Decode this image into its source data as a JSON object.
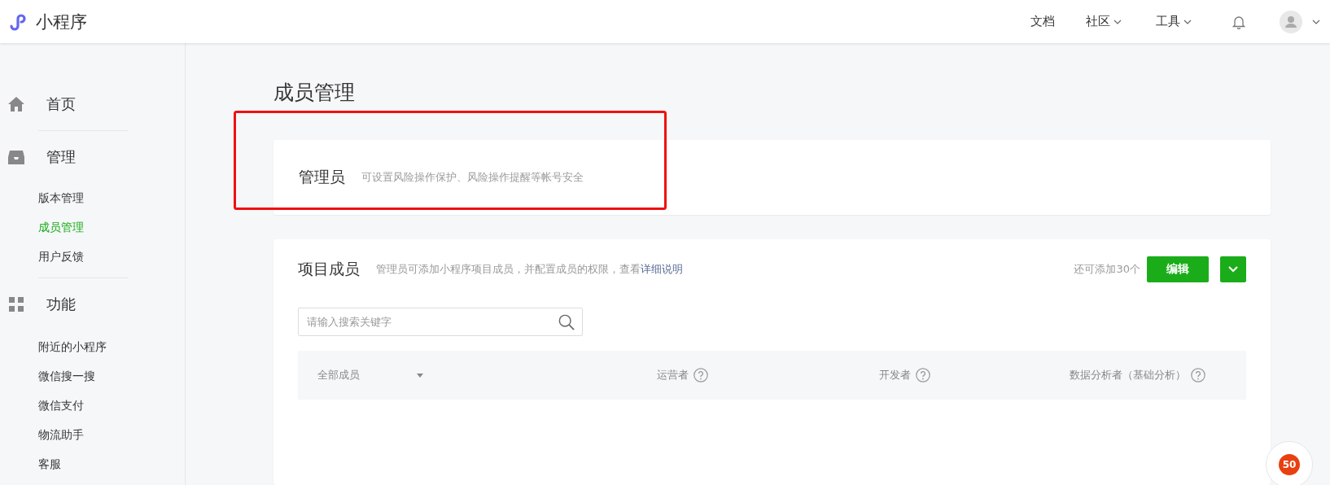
{
  "header": {
    "logo_text": "小程序",
    "nav": [
      {
        "label": "文档",
        "kind": "link"
      },
      {
        "label": "社区",
        "kind": "dropdown"
      },
      {
        "label": "工具",
        "kind": "dropdown"
      }
    ]
  },
  "sidebar": {
    "groups": [
      {
        "title": "首页",
        "kind": "home"
      },
      {
        "title": "管理",
        "kind": "inbox",
        "items": [
          {
            "label": "版本管理",
            "selected": false
          },
          {
            "label": "成员管理",
            "selected": true
          },
          {
            "label": "用户反馈",
            "selected": false
          }
        ]
      },
      {
        "title": "功能",
        "kind": "grid",
        "items": [
          {
            "label": "附近的小程序",
            "selected": false
          },
          {
            "label": "微信搜一搜",
            "selected": false
          },
          {
            "label": "微信支付",
            "selected": false
          },
          {
            "label": "物流助手",
            "selected": false
          },
          {
            "label": "客服",
            "selected": false
          }
        ]
      }
    ]
  },
  "page_title": "成员管理",
  "admin_card": {
    "title": "管理员",
    "description": "可设置风险操作保护、风险操作提醒等帐号安全"
  },
  "members_card": {
    "title": "项目成员",
    "description": "管理员可添加小程序项目成员，并配置成员的权限，查看",
    "link": "详细说明",
    "remaining": "还可添加30个",
    "edit_button": "编辑",
    "search": {
      "placeholder": "请输入搜索关键字"
    },
    "columns": [
      {
        "label": "全部成员",
        "kind": "filter"
      },
      {
        "label": "运营者",
        "kind": "help"
      },
      {
        "label": "开发者",
        "kind": "help"
      },
      {
        "label": "数据分析者（基础分析）",
        "kind": "help"
      }
    ]
  },
  "float_badge": "50"
}
